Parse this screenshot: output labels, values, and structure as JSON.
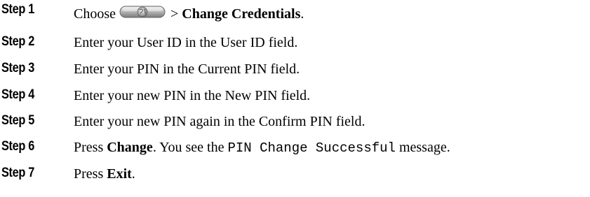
{
  "steps": [
    {
      "label": "Step 1",
      "pre": "Choose",
      "icon": "applications-globe-icon",
      "mid": " > ",
      "bold": "Change Credentials",
      "post": "."
    },
    {
      "label": "Step 2",
      "text": "Enter your User ID in the User ID field."
    },
    {
      "label": "Step 3",
      "text": "Enter your PIN in the Current PIN field."
    },
    {
      "label": "Step 4",
      "text": "Enter your new PIN in the New PIN field."
    },
    {
      "label": "Step 5",
      "text": "Enter your new PIN again in the Confirm PIN field."
    },
    {
      "label": "Step 6",
      "pre": "Press ",
      "bold": "Change",
      "mid": ". You see the ",
      "mono": "PIN Change Successful",
      "post": " message."
    },
    {
      "label": "Step 7",
      "pre": "Press ",
      "bold": "Exit",
      "post": "."
    }
  ]
}
